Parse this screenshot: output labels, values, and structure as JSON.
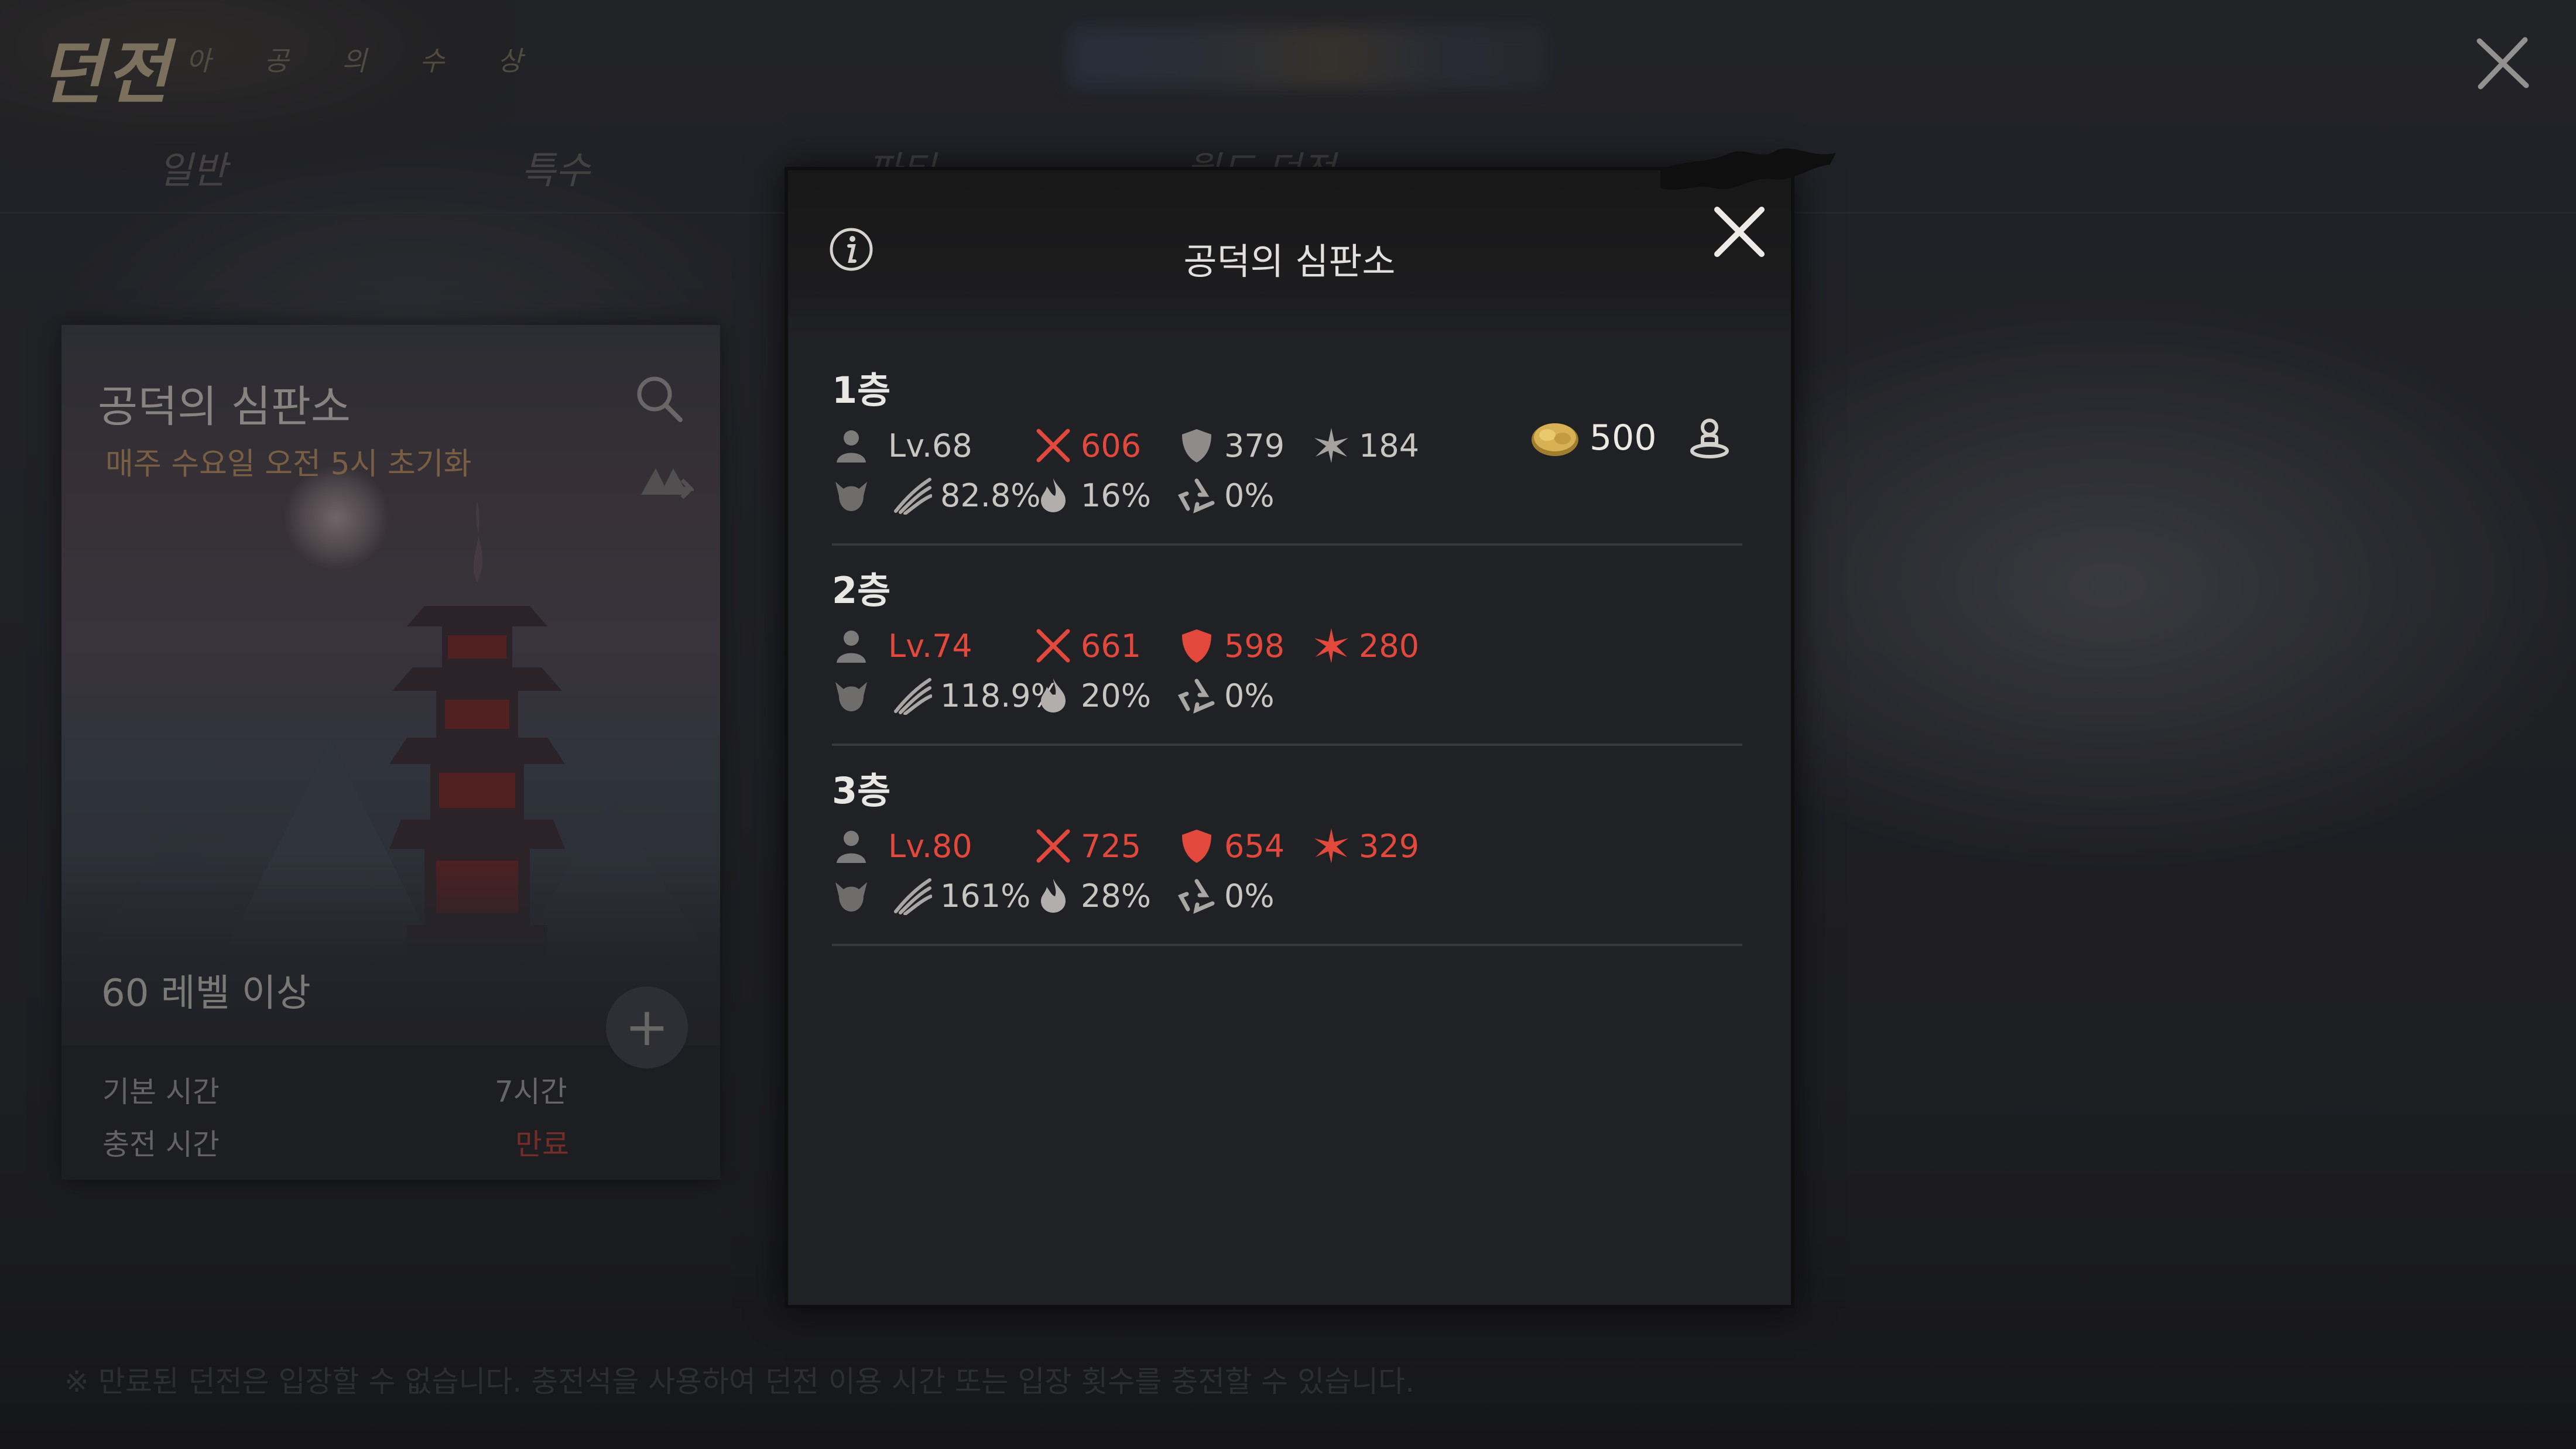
{
  "header": {
    "title": "던전",
    "subtitle": "아 공 의 수 상",
    "tabs": [
      "일반",
      "특수",
      "파티",
      "월드 던전"
    ]
  },
  "dungeon_card": {
    "title": "공덕의 심판소",
    "reset_text": "매주 수요일 오전 5시 초기화",
    "level_requirement": "60 레벨 이상",
    "base_time_label": "기본 시간",
    "base_time_value": "7시간",
    "charge_time_label": "충전 시간",
    "charge_time_value": "만료",
    "plus_label": "+"
  },
  "notice": "※ 만료된 던전은 입장할 수 없습니다. 충전석을 사용하여 던전 이용 시간 또는 입장 횟수를 충전할 수 있습니다.",
  "modal": {
    "title": "공덕의 심판소",
    "info_icon": "info-icon",
    "close_icon": "close-icon",
    "floors": [
      {
        "name": "1층",
        "level": "Lv.68",
        "level_color": "normal",
        "attack": "606",
        "attack_color": "red",
        "defense": "379",
        "defense_color": "normal",
        "hit": "184",
        "hit_color": "normal",
        "damage_bonus": "82.8%",
        "fire": "16%",
        "resist": "0%",
        "reward_amount": "500",
        "reward_icon": "coin-icon",
        "party_icon": "character-icon"
      },
      {
        "name": "2층",
        "level": "Lv.74",
        "level_color": "red",
        "attack": "661",
        "attack_color": "red",
        "defense": "598",
        "defense_color": "red",
        "hit": "280",
        "hit_color": "red",
        "damage_bonus": "118.9%",
        "fire": "20%",
        "resist": "0%"
      },
      {
        "name": "3층",
        "level": "Lv.80",
        "level_color": "red",
        "attack": "725",
        "attack_color": "red",
        "defense": "654",
        "defense_color": "red",
        "hit": "329",
        "hit_color": "red",
        "damage_bonus": "161%",
        "fire": "28%",
        "resist": "0%"
      }
    ]
  },
  "colors": {
    "red": "#e2483b",
    "normal_text": "#c9c6c1",
    "modal_bg": "#202124",
    "gold": "#c9a24a"
  }
}
